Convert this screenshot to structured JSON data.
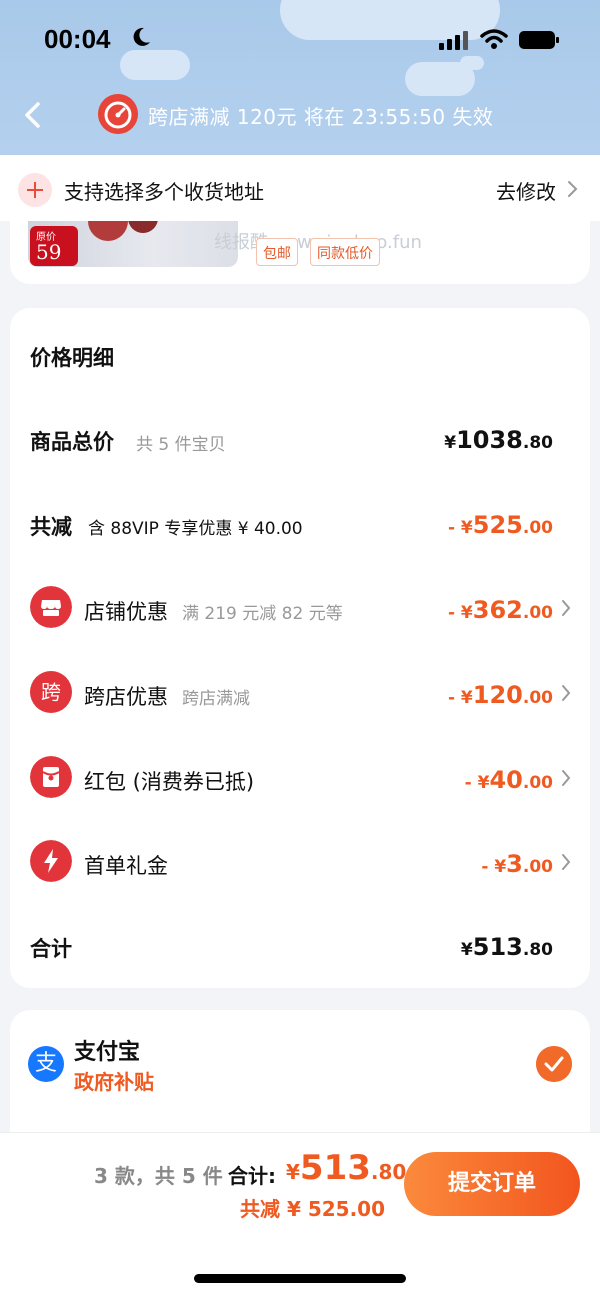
{
  "status_bar": {
    "time": "00:04"
  },
  "header": {
    "promo_text": "跨店满减 120元 将在 23:55:50 失效"
  },
  "address": {
    "label": "支持选择多个收货地址",
    "edit": "去修改"
  },
  "product": {
    "price_tag_label": "原价",
    "price_tag_value": "59",
    "watermark": "线报酷-new.xianbao.fun",
    "tags": [
      "包邮",
      "同款低价"
    ]
  },
  "price_detail": {
    "title": "价格明细",
    "rows": [
      {
        "label": "商品总价",
        "sub": "共 5 件宝贝",
        "amount": {
          "currency": "¥",
          "int": "1038",
          "dec": ".80"
        }
      },
      {
        "label": "共减",
        "sub": "含 88VIP 专享优惠 ¥ 40.00",
        "amount": {
          "prefix": "- ",
          "currency": "¥",
          "int": "525",
          "dec": ".00"
        }
      },
      {
        "label": "店铺优惠",
        "sub": "满 219 元减 82 元等",
        "amount": {
          "prefix": "- ",
          "currency": "¥",
          "int": "362",
          "dec": ".00"
        },
        "icon": "shop-icon"
      },
      {
        "label": "跨店优惠",
        "sub": "跨店满减",
        "icon_char": "跨",
        "amount": {
          "prefix": "- ",
          "currency": "¥",
          "int": "120",
          "dec": ".00"
        },
        "icon": "cross-store-icon"
      },
      {
        "label": "红包 (消费券已抵)",
        "sub": "",
        "amount": {
          "prefix": "- ",
          "currency": "¥",
          "int": "40",
          "dec": ".00"
        },
        "icon": "red-packet-icon"
      },
      {
        "label": "首单礼金",
        "sub": "",
        "amount": {
          "prefix": "- ",
          "currency": "¥",
          "int": "3",
          "dec": ".00"
        },
        "icon": "lightning-icon"
      },
      {
        "label": "合计",
        "sub": "",
        "amount": {
          "currency": "¥",
          "int": "513",
          "dec": ".80"
        }
      }
    ]
  },
  "payment": {
    "icon_char": "支",
    "name": "支付宝",
    "sub": "政府补贴"
  },
  "bottom_bar": {
    "count": "3 款，共 5 件",
    "total_label": "合计:",
    "total": {
      "currency": "¥",
      "int": "513",
      "dec": ".80"
    },
    "saved": "共减 ¥ 525.00",
    "submit": "提交订单"
  },
  "colors": {
    "accent": "#ef5a21",
    "header_bg": "#a9c9ea",
    "icon_red": "#e2353b"
  }
}
